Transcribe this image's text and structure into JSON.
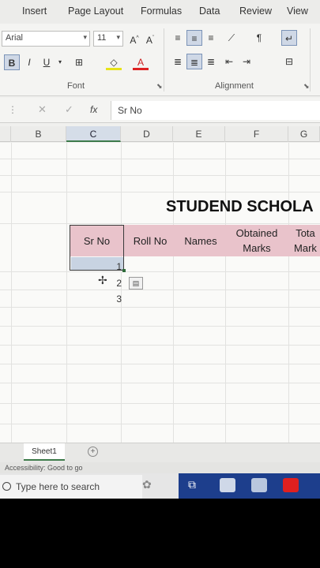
{
  "ribbon": {
    "tabs": [
      "Insert",
      "Page Layout",
      "Formulas",
      "Data",
      "Review",
      "View"
    ],
    "font_name": "Arial",
    "font_size": "11",
    "groups": {
      "font": "Font",
      "alignment": "Alignment"
    }
  },
  "formula_bar": {
    "fx": "fx",
    "value": "Sr No"
  },
  "columns": [
    "B",
    "C",
    "D",
    "E",
    "F",
    "G"
  ],
  "sheet": {
    "title": "STUDEND SCHOLA",
    "headers": [
      "Sr No",
      "Roll No",
      "Names",
      "Obtained Marks",
      "Tota Mark"
    ],
    "header_lines": [
      [
        "Sr No"
      ],
      [
        "Roll No"
      ],
      [
        "Names"
      ],
      [
        "Obtained",
        "Marks"
      ],
      [
        "Tota",
        "Mark"
      ]
    ],
    "serials": [
      "1",
      "2",
      "3"
    ]
  },
  "sheet_tabs": {
    "active": "Sheet1"
  },
  "status": {
    "accessibility": "Accessibility: Good to go"
  },
  "taskbar": {
    "search_placeholder": "Type here to search"
  },
  "colors": {
    "header_fill": "#e9c3cb",
    "selection": "#c8d3e2",
    "accent_green": "#3d7a4a"
  }
}
